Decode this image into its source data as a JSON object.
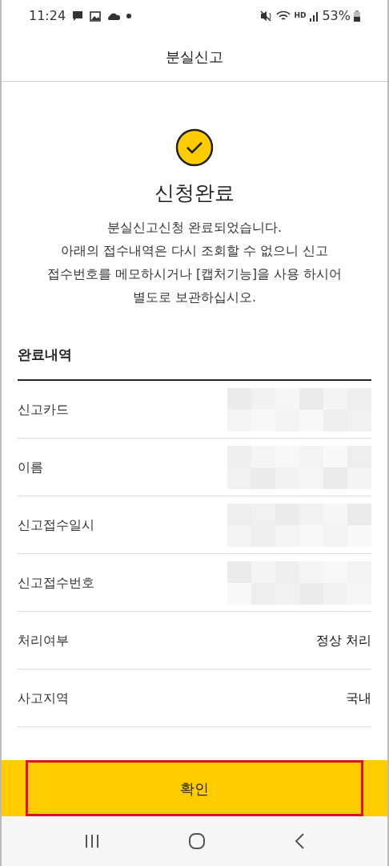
{
  "status_bar": {
    "time": "11:24",
    "hd_label": "HD",
    "battery_text": "53%"
  },
  "header": {
    "title": "분실신고"
  },
  "result": {
    "title": "신청완료",
    "message": [
      "분실신고신청 완료되었습니다.",
      "아래의 접수내역은 다시 조회할 수 없으니 신고",
      "접수번호를 메모하시거나 [캡처기능]을 사용 하시어",
      "별도로 보관하십시오."
    ]
  },
  "details": {
    "title": "완료내역",
    "rows": [
      {
        "label": "신고카드",
        "kind": "redacted"
      },
      {
        "label": "이름",
        "kind": "redacted"
      },
      {
        "label": "신고접수일시",
        "kind": "redacted"
      },
      {
        "label": "신고접수번호",
        "kind": "redacted"
      },
      {
        "label": "처리여부",
        "kind": "text",
        "value": "정상 처리"
      },
      {
        "label": "사고지역",
        "kind": "text",
        "value": "국내"
      }
    ]
  },
  "confirm_button": {
    "label": "확인",
    "highlighted": true
  }
}
